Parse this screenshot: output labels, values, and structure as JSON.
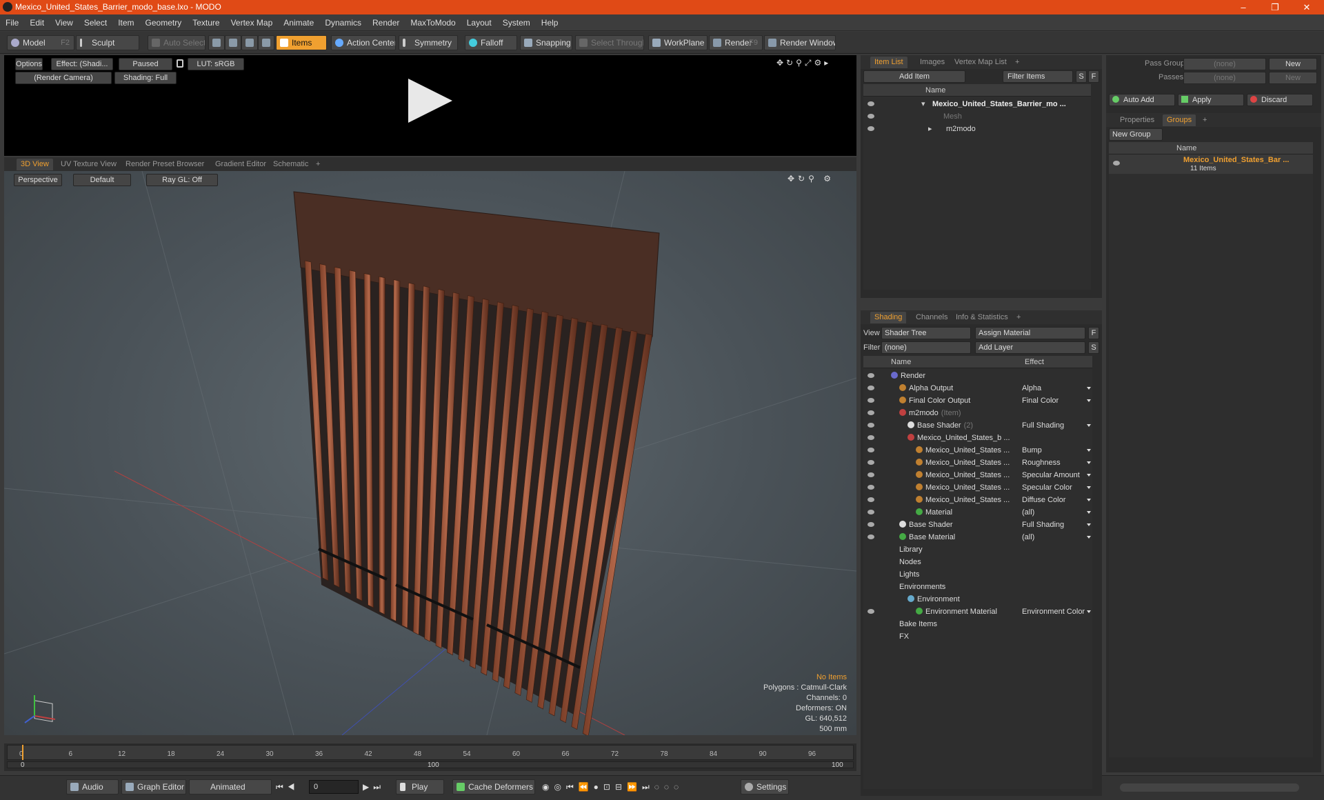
{
  "app": {
    "title": "Mexico_United_States_Barrier_modo_base.lxo - MODO"
  },
  "window": {
    "min": "–",
    "max": "❐",
    "close": "✕"
  },
  "menu": [
    "File",
    "Edit",
    "View",
    "Select",
    "Item",
    "Geometry",
    "Texture",
    "Vertex Map",
    "Animate",
    "Dynamics",
    "Render",
    "MaxToModo",
    "Layout",
    "System",
    "Help"
  ],
  "toolbar": {
    "model": "Model",
    "model_key": "F2",
    "sculpt": "Sculpt",
    "auto_select": "Auto Select",
    "items": "Items",
    "action_center": "Action Center",
    "symmetry": "Symmetry",
    "falloff": "Falloff",
    "snapping": "Snapping",
    "select_through": "Select Through",
    "workplane": "WorkPlane",
    "render": "Render",
    "render_key": "F9",
    "render_window": "Render Window"
  },
  "preview": {
    "options": "Options",
    "effect": "Effect: (Shadi...",
    "paused": "Paused",
    "lut": "LUT: sRGB",
    "camera": "(Render Camera)",
    "shading": "Shading: Full"
  },
  "viewtabs": [
    "3D View",
    "UV Texture View",
    "Render Preset Browser",
    "Gradient Editor",
    "Schematic",
    "+"
  ],
  "viewport": {
    "perspective": "Perspective",
    "default": "Default",
    "raygl": "Ray GL: Off",
    "info": {
      "no_items": "No Items",
      "polygons": "Polygons : Catmull-Clark",
      "channels": "Channels: 0",
      "deformers": "Deformers: ON",
      "gl": "GL: 640,512",
      "unit": "500 mm"
    }
  },
  "timeline": {
    "ticks_top": [
      "0",
      "6",
      "12",
      "18",
      "24",
      "30",
      "36",
      "42",
      "48",
      "54",
      "60",
      "66",
      "72",
      "78",
      "84",
      "90",
      "96"
    ],
    "ticks_bottom": [
      "0",
      "100",
      "100"
    ]
  },
  "bottombar": {
    "audio": "Audio",
    "graph_editor": "Graph Editor",
    "animated": "Animated",
    "frame": "0",
    "play": "Play",
    "cache": "Cache Deformers",
    "settings": "Settings"
  },
  "itemlist": {
    "tabs": [
      "Item List",
      "Images",
      "Vertex Map List",
      "+"
    ],
    "add_item": "Add Item",
    "filter_items": "Filter Items",
    "s": "S",
    "f": "F",
    "col_name": "Name",
    "rows": [
      {
        "label": "Mexico_United_States_Barrier_mo ..."
      },
      {
        "label": "Mesh"
      },
      {
        "label": "m2modo"
      }
    ]
  },
  "shading": {
    "tabs": [
      "Shading",
      "Channels",
      "Info & Statistics",
      "+"
    ],
    "view_label": "View",
    "view_value": "Shader Tree",
    "assign": "Assign Material",
    "filter_label": "Filter",
    "filter_value": "(none)",
    "add_layer": "Add Layer",
    "f": "F",
    "s": "S",
    "col_name": "Name",
    "col_effect": "Effect",
    "rows": [
      {
        "label": "Render",
        "effect": "",
        "indent": 0
      },
      {
        "label": "Alpha Output",
        "effect": "Alpha",
        "indent": 1
      },
      {
        "label": "Final Color Output",
        "effect": "Final Color",
        "indent": 1
      },
      {
        "label": "m2modo",
        "suffix": "(Item)",
        "effect": "",
        "indent": 1
      },
      {
        "label": "Base Shader",
        "suffix": "(2)",
        "effect": "Full Shading",
        "indent": 2
      },
      {
        "label": "Mexico_United_States_b ...",
        "effect": "",
        "indent": 2
      },
      {
        "label": "Mexico_United_States ...",
        "effect": "Bump",
        "indent": 3
      },
      {
        "label": "Mexico_United_States ...",
        "effect": "Roughness",
        "indent": 3
      },
      {
        "label": "Mexico_United_States ...",
        "effect": "Specular Amount",
        "indent": 3
      },
      {
        "label": "Mexico_United_States ...",
        "effect": "Specular Color",
        "indent": 3
      },
      {
        "label": "Mexico_United_States ...",
        "effect": "Diffuse Color",
        "indent": 3
      },
      {
        "label": "Material",
        "effect": "(all)",
        "indent": 3
      },
      {
        "label": "Base Shader",
        "effect": "Full Shading",
        "indent": 1
      },
      {
        "label": "Base Material",
        "effect": "(all)",
        "indent": 1
      },
      {
        "label": "Library",
        "effect": "",
        "indent": 1
      },
      {
        "label": "Nodes",
        "effect": "",
        "indent": 1
      },
      {
        "label": "Lights",
        "effect": "",
        "indent": 1
      },
      {
        "label": "Environments",
        "effect": "",
        "indent": 1
      },
      {
        "label": "Environment",
        "effect": "",
        "indent": 2
      },
      {
        "label": "Environment Material",
        "effect": "Environment Color",
        "indent": 3
      },
      {
        "label": "Bake Items",
        "effect": "",
        "indent": 1
      },
      {
        "label": "FX",
        "effect": "",
        "indent": 1
      }
    ]
  },
  "groups": {
    "pass_groups": "Pass Groups",
    "pass_groups_value": "(none)",
    "new": "New",
    "passes": "Passes",
    "passes_value": "(none)",
    "new2": "New",
    "auto_add": "Auto Add",
    "apply": "Apply",
    "discard": "Discard",
    "tabs": [
      "Properties",
      "Groups",
      "+"
    ],
    "new_group": "New Group",
    "col_name": "Name",
    "item": "Mexico_United_States_Bar ...",
    "count": "11 Items"
  },
  "colors": {
    "accent": "#f0a030",
    "titlebar": "#e04a16"
  }
}
